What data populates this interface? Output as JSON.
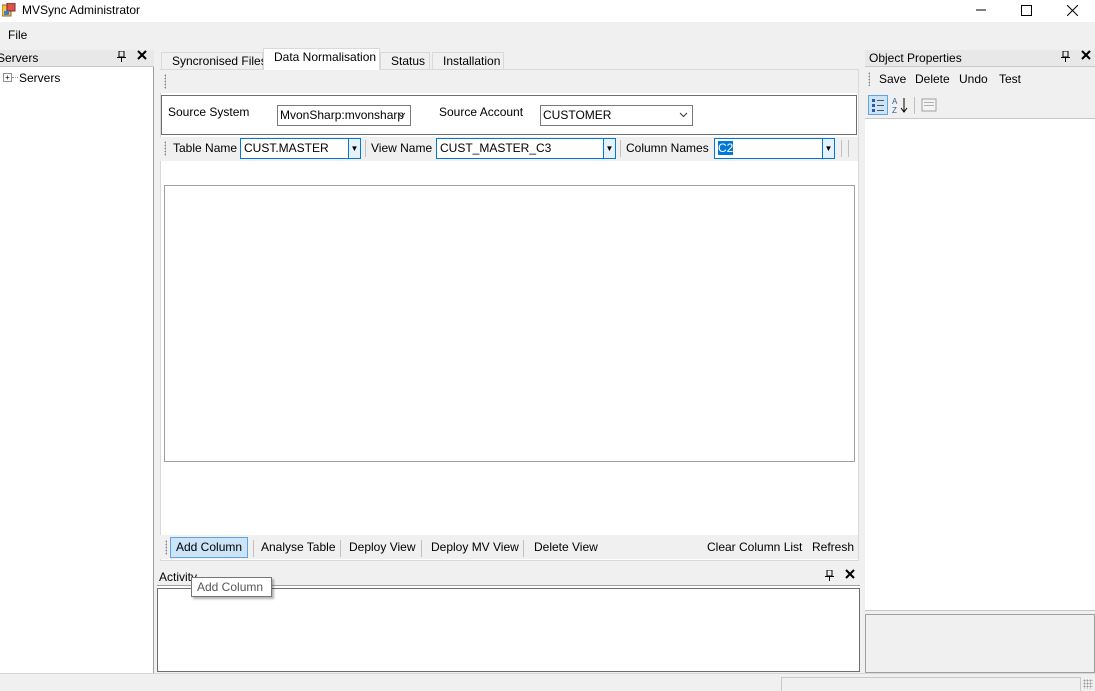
{
  "window": {
    "title": "MVSync Administrator"
  },
  "menu": {
    "file": "File"
  },
  "servers_panel": {
    "title": "Servers",
    "tree_root": "Servers"
  },
  "tabs": [
    {
      "label": "Syncronised Files"
    },
    {
      "label": "Data Normalisation"
    },
    {
      "label": "Status"
    },
    {
      "label": "Installation"
    }
  ],
  "source": {
    "system_label": "Source System",
    "system_value": "MvonSharp:mvonsharp",
    "account_label": "Source Account",
    "account_value": "CUSTOMER"
  },
  "filters": {
    "table_label": "Table Name",
    "table_value": "CUST.MASTER",
    "view_label": "View Name",
    "view_value": "CUST_MASTER_C3",
    "column_label": "Column Names",
    "column_value": "C2"
  },
  "actions": {
    "add_column": "Add Column",
    "analyse_table": "Analyse Table",
    "deploy_view": "Deploy View",
    "deploy_mv_view": "Deploy MV View",
    "delete_view": "Delete View",
    "clear_column_list": "Clear Column List",
    "refresh": "Refresh"
  },
  "activity": {
    "title": "Activity"
  },
  "tooltip": {
    "text": "Add Column"
  },
  "properties": {
    "title": "Object Properties",
    "save": "Save",
    "delete": "Delete",
    "undo": "Undo",
    "test": "Test"
  },
  "colors": {
    "accent": "#0078d7",
    "hover_bg": "#cce4f7"
  }
}
